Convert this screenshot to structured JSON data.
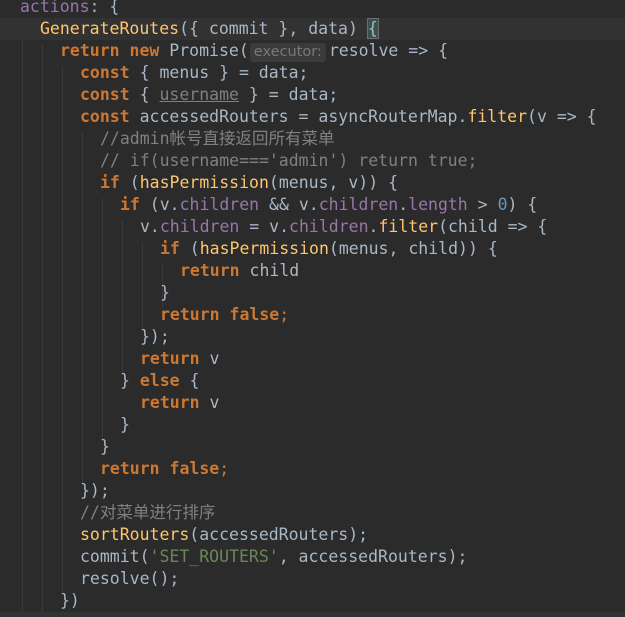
{
  "code": {
    "l1_key": "actions",
    "l1_rest": ": {",
    "l2_fn": "GenerateRoutes",
    "l2_a": "({ ",
    "l2_commit": "commit",
    "l2_b": " }, ",
    "l2_data": "data",
    "l2_c": ") ",
    "l2_brace": "{",
    "l3_return": "return",
    "l3_new": "new",
    "l3_promise": "Promise(",
    "l3_hint": "executor:",
    "l3_rest": "resolve => {",
    "l4_const": "const",
    "l4_rest": " { menus } = data;",
    "l5_const": "const",
    "l5_a": " { ",
    "l5_username": "username",
    "l5_b": " } = data;",
    "l6_const": "const",
    "l6_a": " accessedRouters = asyncRouterMap.",
    "l6_filter": "filter",
    "l6_b": "(v => {",
    "l7_comment": "//admin帐号直接返回所有菜单",
    "l8_comment": "// if(username==='admin') return true;",
    "l9_if": "if",
    "l9_a": " (",
    "l9_fn": "hasPermission",
    "l9_b": "(menus, v)) {",
    "l10_if": "if",
    "l10_a": " (v.",
    "l10_children": "children",
    "l10_b": " && v.",
    "l10_children2": "children",
    "l10_dot": ".",
    "l10_length": "length",
    "l10_gt": " > ",
    "l10_zero": "0",
    "l10_c": ") {",
    "l11_a": "v.",
    "l11_children": "children",
    "l11_b": " = v.",
    "l11_children2": "children",
    "l11_dot": ".",
    "l11_filter": "filter",
    "l11_c": "(child => {",
    "l12_if": "if",
    "l12_a": " (",
    "l12_fn": "hasPermission",
    "l12_b": "(menus, child)) {",
    "l13_return": "return",
    "l13_rest": " child",
    "l14": "}",
    "l15_return": "return",
    "l15_false": "false",
    "l15_semi": ";",
    "l16": "});",
    "l17_return": "return",
    "l17_rest": " v",
    "l18_a": "} ",
    "l18_else": "else",
    "l18_b": " {",
    "l19_return": "return",
    "l19_rest": " v",
    "l20": "}",
    "l21": "}",
    "l22_return": "return",
    "l22_false": "false",
    "l22_semi": ";",
    "l23": "});",
    "l24_comment": "//对菜单进行排序",
    "l25_fn": "sortRouters",
    "l25_rest": "(accessedRouters);",
    "l26_a": "commit(",
    "l26_str": "'SET_ROUTERS'",
    "l26_b": ", accessedRouters);",
    "l27": "resolve();",
    "l28": "})"
  }
}
